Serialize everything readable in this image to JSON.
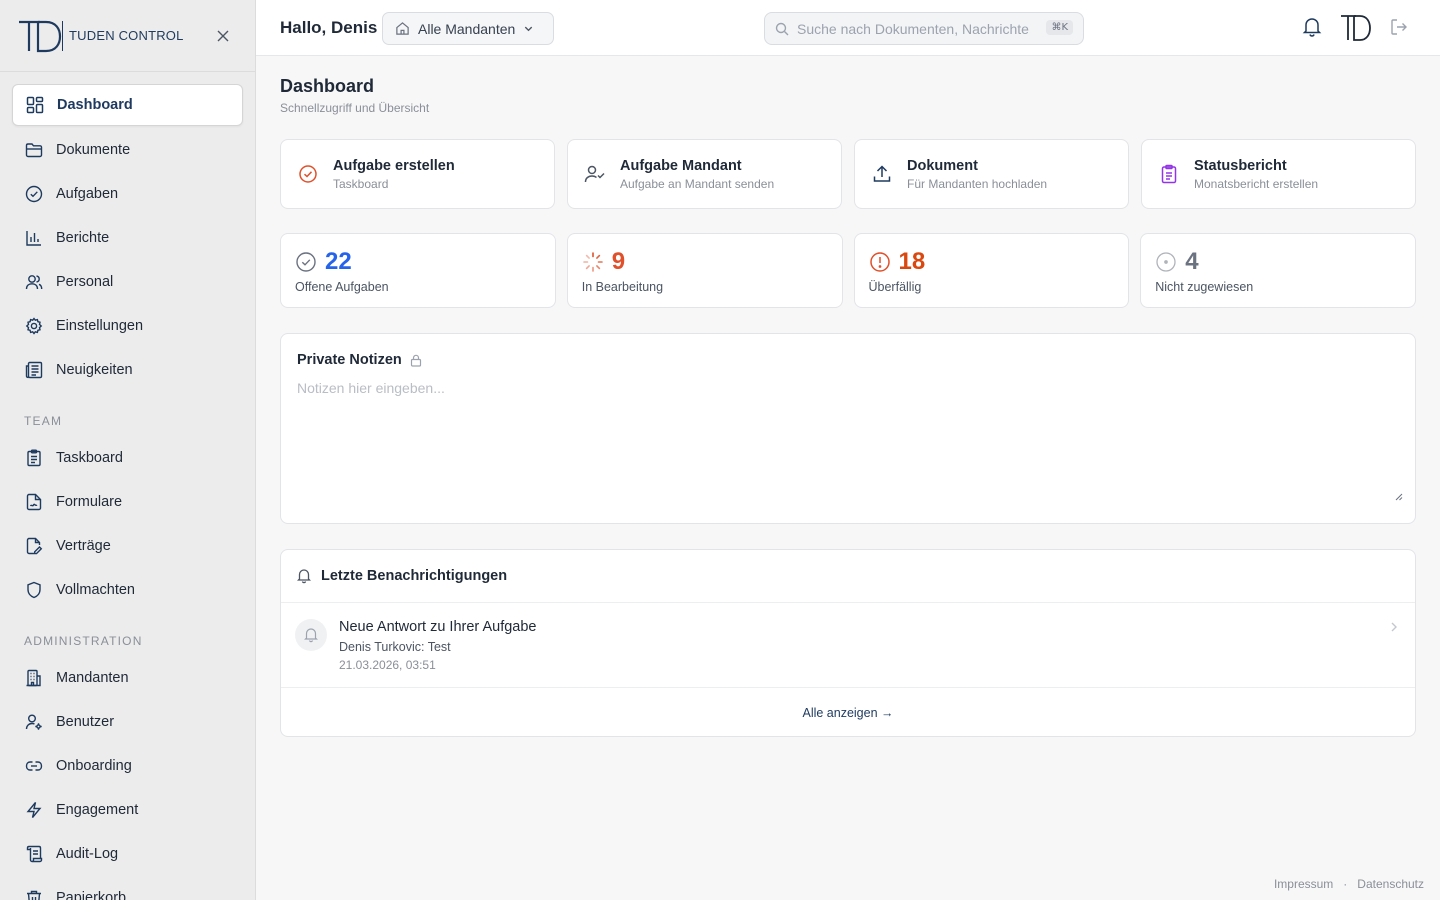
{
  "brand": {
    "logo_text": "TD",
    "name": "TUDEN CONTROL"
  },
  "sidebar": {
    "items": [
      {
        "label": "Dashboard",
        "icon": "layout-grid-icon"
      },
      {
        "label": "Dokumente",
        "icon": "folder-icon"
      },
      {
        "label": "Aufgaben",
        "icon": "check-circle-icon"
      },
      {
        "label": "Berichte",
        "icon": "bar-chart-icon"
      },
      {
        "label": "Personal",
        "icon": "users-icon"
      },
      {
        "label": "Einstellungen",
        "icon": "gear-icon"
      },
      {
        "label": "Neuigkeiten",
        "icon": "newspaper-icon"
      }
    ],
    "team_label": "TEAM",
    "team_items": [
      {
        "label": "Taskboard",
        "icon": "clipboard-icon"
      },
      {
        "label": "Formulare",
        "icon": "file-signature-icon"
      },
      {
        "label": "Verträge",
        "icon": "file-edit-icon"
      },
      {
        "label": "Vollmachten",
        "icon": "shield-icon"
      }
    ],
    "admin_label": "ADMINISTRATION",
    "admin_items": [
      {
        "label": "Mandanten",
        "icon": "building-icon"
      },
      {
        "label": "Benutzer",
        "icon": "user-gear-icon"
      },
      {
        "label": "Onboarding",
        "icon": "link-icon"
      },
      {
        "label": "Engagement",
        "icon": "lightning-icon"
      },
      {
        "label": "Audit-Log",
        "icon": "scroll-icon"
      },
      {
        "label": "Papierkorb",
        "icon": "trash-icon"
      }
    ]
  },
  "header": {
    "greeting": "Hallo, Denis",
    "client_select": "Alle Mandanten",
    "search_placeholder": "Suche nach Dokumenten, Nachrichten...",
    "search_shortcut": "⌘K"
  },
  "main": {
    "title": "Dashboard",
    "subtitle": "Schnellzugriff und Übersicht",
    "quick_actions": [
      {
        "title": "Aufgabe erstellen",
        "subtitle": "Taskboard",
        "color": "#e0502a"
      },
      {
        "title": "Aufgabe Mandant",
        "subtitle": "Aufgabe an Mandant senden",
        "color": "#4b5563"
      },
      {
        "title": "Dokument",
        "subtitle": "Für Mandanten hochladen",
        "color": "#1e3a5f"
      },
      {
        "title": "Statusbericht",
        "subtitle": "Monatsbericht erstellen",
        "color": "#9333ea"
      }
    ],
    "stats": [
      {
        "value": "22",
        "label": "Offene Aufgaben",
        "color": "#2563eb"
      },
      {
        "value": "9",
        "label": "In Bearbeitung",
        "color": "#e0502a"
      },
      {
        "value": "18",
        "label": "Überfällig",
        "color": "#d9480f"
      },
      {
        "value": "4",
        "label": "Nicht zugewiesen",
        "color": "#6b7280"
      }
    ],
    "notes": {
      "title": "Private Notizen",
      "placeholder": "Notizen hier eingeben..."
    },
    "notifications": {
      "title": "Letzte Benachrichtigungen",
      "items": [
        {
          "title": "Neue Antwort zu Ihrer Aufgabe",
          "message": "Denis Turkovic: Test",
          "time": "21.03.2026, 03:51"
        }
      ],
      "show_all": "Alle anzeigen →"
    }
  },
  "footer": {
    "impressum": "Impressum",
    "separator": "·",
    "datenschutz": "Datenschutz"
  }
}
